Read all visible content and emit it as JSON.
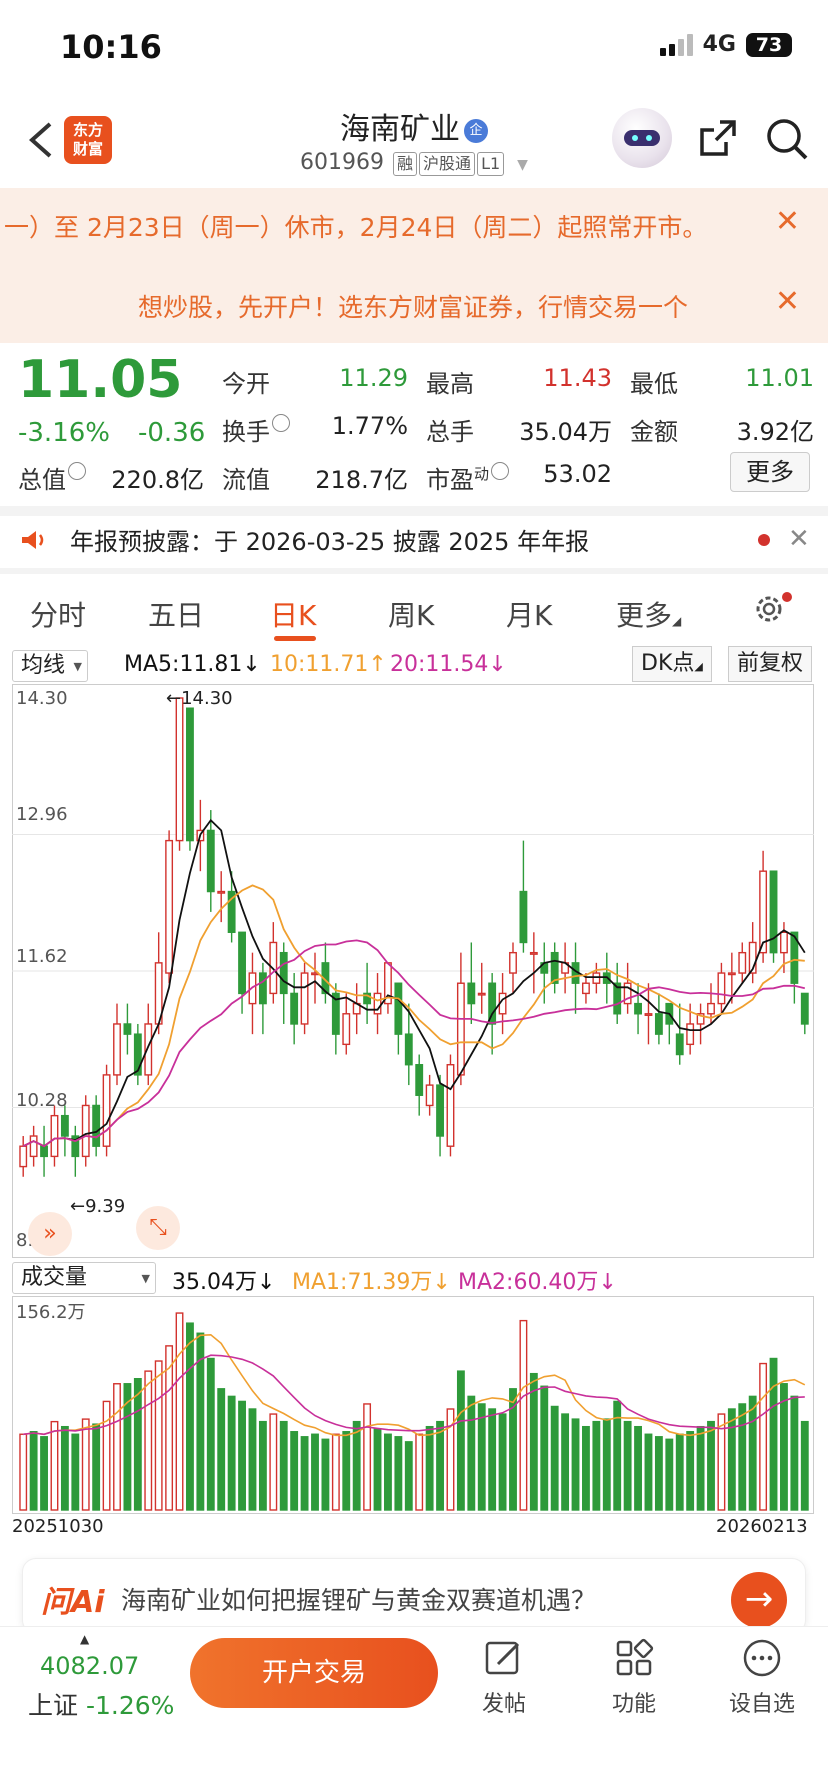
{
  "status": {
    "time": "10:16",
    "network": "4G",
    "battery": "73"
  },
  "header": {
    "logo_text": "东方财富",
    "name": "海南矿业",
    "badge": "企",
    "code": "601969",
    "tags": [
      "融",
      "沪股通",
      "L1"
    ]
  },
  "notices": [
    "一）至 2月23日（周一）休市，2月24日（周二）起照常开市。",
    "想炒股，先开户！选东方财富证券，行情交易一个"
  ],
  "quote": {
    "price": "11.05",
    "change_pct": "-3.16%",
    "change": "-0.36",
    "open_label": "今开",
    "open": "11.29",
    "high_label": "最高",
    "high": "11.43",
    "low_label": "最低",
    "low": "11.01",
    "turnover_label": "换手",
    "turnover": "1.77%",
    "volume_label": "总手",
    "volume": "35.04万",
    "amount_label": "金额",
    "amount": "3.92亿",
    "mktcap_label": "总值",
    "mktcap": "220.8亿",
    "float_label": "流值",
    "float": "218.7亿",
    "pe_label": "市盈",
    "pe_sup": "动",
    "pe": "53.02",
    "more": "更多"
  },
  "announcement": "年报预披露：于 2026-03-25 披露 2025 年年报",
  "tabs": [
    "分时",
    "五日",
    "日K",
    "周K",
    "月K",
    "更多"
  ],
  "active_tab": "日K",
  "legend": {
    "selector": "均线",
    "ma5": "MA5:11.81",
    "ma10": "10:11.71",
    "ma20": "20:11.54",
    "dk_button": "DK点",
    "adjust_button": "前复权"
  },
  "vol_legend": {
    "selector": "成交量",
    "vol": "35.04万",
    "ma1": "MA1:71.39万",
    "ma2": "MA2:60.40万"
  },
  "colors": {
    "up": "#d2322d",
    "down": "#2e9a3a",
    "accent": "#e8501e",
    "ma5": "#111111",
    "ma10": "#f0a030",
    "ma20": "#c8309a"
  },
  "chart_data": {
    "type": "candlestick",
    "y_ticks": [
      "14.30",
      "12.96",
      "11.62",
      "10.28",
      "8.94"
    ],
    "ylim": [
      8.94,
      14.3
    ],
    "high_marker": "14.30",
    "low_marker": "9.39",
    "x_start_label": "20251030",
    "x_end_label": "20260213",
    "vol_top_label": "156.2万",
    "candles": [
      [
        9.7,
        9.9,
        9.6,
        10.0
      ],
      [
        9.8,
        10.0,
        9.7,
        10.1
      ],
      [
        9.9,
        9.8,
        9.6,
        10.1
      ],
      [
        9.8,
        10.2,
        9.7,
        10.3
      ],
      [
        10.2,
        10.0,
        9.8,
        10.3
      ],
      [
        10.0,
        9.8,
        9.6,
        10.1
      ],
      [
        9.8,
        10.3,
        9.7,
        10.4
      ],
      [
        10.3,
        9.9,
        9.8,
        10.4
      ],
      [
        9.9,
        10.6,
        9.8,
        10.7
      ],
      [
        10.6,
        11.1,
        10.5,
        11.3
      ],
      [
        11.1,
        11.0,
        10.8,
        11.3
      ],
      [
        11.0,
        10.6,
        10.5,
        11.1
      ],
      [
        10.6,
        11.1,
        10.5,
        11.3
      ],
      [
        11.1,
        11.7,
        11.0,
        12.0
      ],
      [
        11.6,
        12.9,
        11.5,
        13.0
      ],
      [
        12.9,
        14.3,
        12.8,
        14.3
      ],
      [
        14.2,
        12.9,
        12.8,
        14.2
      ],
      [
        12.9,
        13.0,
        12.6,
        13.3
      ],
      [
        13.0,
        12.4,
        12.2,
        13.2
      ],
      [
        12.4,
        12.4,
        12.1,
        12.6
      ],
      [
        12.4,
        12.0,
        11.9,
        12.6
      ],
      [
        12.0,
        11.4,
        11.2,
        12.0
      ],
      [
        11.3,
        11.6,
        11.0,
        11.8
      ],
      [
        11.6,
        11.3,
        11.0,
        11.7
      ],
      [
        11.4,
        11.9,
        11.3,
        12.1
      ],
      [
        11.8,
        11.4,
        11.1,
        11.9
      ],
      [
        11.4,
        11.1,
        10.9,
        11.6
      ],
      [
        11.1,
        11.6,
        11.0,
        11.7
      ],
      [
        11.6,
        11.6,
        11.3,
        11.8
      ],
      [
        11.7,
        11.4,
        11.3,
        11.9
      ],
      [
        11.4,
        11.0,
        10.8,
        11.5
      ],
      [
        10.9,
        11.2,
        10.8,
        11.4
      ],
      [
        11.2,
        11.3,
        11.0,
        11.5
      ],
      [
        11.4,
        11.3,
        11.1,
        11.7
      ],
      [
        11.2,
        11.4,
        11.0,
        11.6
      ],
      [
        11.3,
        11.7,
        11.2,
        11.7
      ],
      [
        11.5,
        11.0,
        10.8,
        11.5
      ],
      [
        11.0,
        10.7,
        10.5,
        11.3
      ],
      [
        10.7,
        10.4,
        10.2,
        10.8
      ],
      [
        10.3,
        10.5,
        10.2,
        10.6
      ],
      [
        10.5,
        10.0,
        9.8,
        10.6
      ],
      [
        9.9,
        10.7,
        9.8,
        10.8
      ],
      [
        10.6,
        11.5,
        10.5,
        11.8
      ],
      [
        11.5,
        11.3,
        11.1,
        11.9
      ],
      [
        11.4,
        11.4,
        11.2,
        11.7
      ],
      [
        11.5,
        11.1,
        10.8,
        11.6
      ],
      [
        11.2,
        11.4,
        11.0,
        11.6
      ],
      [
        11.6,
        11.8,
        11.4,
        11.9
      ],
      [
        12.4,
        11.9,
        11.8,
        12.9
      ],
      [
        11.8,
        11.8,
        11.4,
        12.0
      ],
      [
        11.7,
        11.6,
        11.3,
        11.9
      ],
      [
        11.8,
        11.5,
        11.4,
        11.9
      ],
      [
        11.6,
        11.7,
        11.4,
        11.9
      ],
      [
        11.7,
        11.5,
        11.2,
        11.9
      ],
      [
        11.4,
        11.5,
        11.3,
        11.6
      ],
      [
        11.5,
        11.6,
        11.4,
        11.7
      ],
      [
        11.6,
        11.5,
        11.3,
        11.8
      ],
      [
        11.5,
        11.2,
        11.1,
        11.7
      ],
      [
        11.3,
        11.5,
        11.2,
        11.7
      ],
      [
        11.3,
        11.2,
        11.0,
        11.5
      ],
      [
        11.2,
        11.2,
        10.9,
        11.5
      ],
      [
        11.2,
        11.0,
        10.9,
        11.4
      ],
      [
        11.3,
        11.1,
        10.9,
        11.3
      ],
      [
        11.0,
        10.8,
        10.7,
        11.3
      ],
      [
        10.9,
        11.1,
        10.8,
        11.3
      ],
      [
        11.1,
        11.2,
        10.9,
        11.3
      ],
      [
        11.2,
        11.3,
        11.1,
        11.5
      ],
      [
        11.3,
        11.6,
        11.2,
        11.7
      ],
      [
        11.6,
        11.6,
        11.3,
        11.8
      ],
      [
        11.6,
        11.8,
        11.5,
        11.9
      ],
      [
        11.6,
        11.9,
        11.5,
        12.1
      ],
      [
        11.8,
        12.6,
        11.7,
        12.8
      ],
      [
        12.6,
        11.8,
        11.7,
        12.6
      ],
      [
        11.8,
        12.0,
        11.6,
        12.1
      ],
      [
        12.0,
        11.5,
        11.3,
        12.0
      ],
      [
        11.4,
        11.1,
        11.0,
        11.4
      ]
    ],
    "volumes": [
      [
        60,
        1
      ],
      [
        62,
        0
      ],
      [
        58,
        0
      ],
      [
        70,
        1
      ],
      [
        66,
        0
      ],
      [
        60,
        0
      ],
      [
        72,
        1
      ],
      [
        68,
        0
      ],
      [
        86,
        1
      ],
      [
        100,
        1
      ],
      [
        100,
        0
      ],
      [
        104,
        0
      ],
      [
        110,
        1
      ],
      [
        118,
        1
      ],
      [
        130,
        1
      ],
      [
        156,
        1
      ],
      [
        148,
        0
      ],
      [
        140,
        0
      ],
      [
        120,
        0
      ],
      [
        96,
        0
      ],
      [
        90,
        0
      ],
      [
        86,
        0
      ],
      [
        80,
        0
      ],
      [
        70,
        0
      ],
      [
        76,
        1
      ],
      [
        70,
        0
      ],
      [
        62,
        0
      ],
      [
        58,
        0
      ],
      [
        60,
        0
      ],
      [
        56,
        0
      ],
      [
        60,
        1
      ],
      [
        62,
        0
      ],
      [
        70,
        0
      ],
      [
        84,
        1
      ],
      [
        64,
        0
      ],
      [
        60,
        0
      ],
      [
        58,
        0
      ],
      [
        54,
        0
      ],
      [
        60,
        1
      ],
      [
        66,
        0
      ],
      [
        70,
        0
      ],
      [
        80,
        1
      ],
      [
        110,
        0
      ],
      [
        90,
        0
      ],
      [
        84,
        0
      ],
      [
        80,
        0
      ],
      [
        76,
        0
      ],
      [
        96,
        0
      ],
      [
        150,
        1
      ],
      [
        108,
        0
      ],
      [
        98,
        0
      ],
      [
        82,
        0
      ],
      [
        76,
        0
      ],
      [
        72,
        0
      ],
      [
        66,
        0
      ],
      [
        70,
        0
      ],
      [
        72,
        0
      ],
      [
        86,
        0
      ],
      [
        70,
        0
      ],
      [
        66,
        0
      ],
      [
        60,
        0
      ],
      [
        58,
        0
      ],
      [
        56,
        0
      ],
      [
        60,
        0
      ],
      [
        62,
        0
      ],
      [
        66,
        0
      ],
      [
        70,
        0
      ],
      [
        76,
        1
      ],
      [
        80,
        0
      ],
      [
        84,
        0
      ],
      [
        90,
        0
      ],
      [
        116,
        1
      ],
      [
        120,
        0
      ],
      [
        100,
        0
      ],
      [
        90,
        0
      ],
      [
        70,
        0
      ]
    ]
  },
  "ai": {
    "logo": "问Ai",
    "text": "海南矿业如何把握锂矿与黄金双赛道机遇？"
  },
  "bottom": {
    "index_value": "4082.07",
    "index_name": "上证",
    "index_pct": "-1.26%",
    "trade": "开户交易",
    "post": "发帖",
    "func": "功能",
    "watch": "设自选"
  }
}
